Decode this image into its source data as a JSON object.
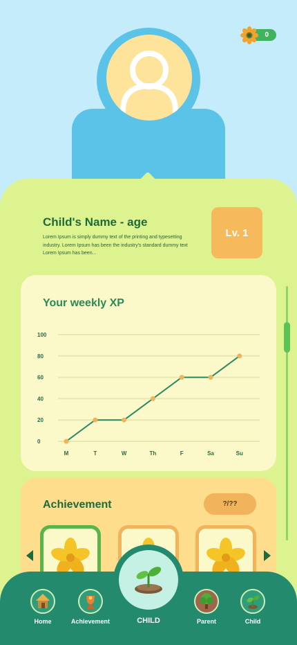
{
  "coins": {
    "count": "0"
  },
  "profile": {
    "name": "Child's Name - age",
    "description": "Lorem Ipsum is simply dummy text of the printing and typesetting industry. Lorem Ipsum has been the industry's standard dummy text Lorem Ipsum has been...",
    "level": "Lv. 1"
  },
  "weekly_xp": {
    "title": "Your weekly XP"
  },
  "chart_data": {
    "type": "line",
    "title": "Your weekly XP",
    "categories": [
      "M",
      "T",
      "W",
      "Th",
      "F",
      "Sa",
      "Su"
    ],
    "values": [
      0,
      20,
      20,
      40,
      60,
      60,
      80
    ],
    "yticks": [
      0,
      20,
      40,
      60,
      80,
      100
    ],
    "ylim": [
      0,
      100
    ],
    "grid": true,
    "line_color": "#2a8a62",
    "point_color": "#f0b35a"
  },
  "achievement": {
    "title": "Achievement",
    "count": "?/??",
    "badges": [
      {
        "name": "star-badge",
        "selected": true
      },
      {
        "name": "star-badge",
        "selected": false
      },
      {
        "name": "star-badge",
        "selected": false
      }
    ]
  },
  "nav": {
    "center_label": "CHILD",
    "items": [
      {
        "label": "Home",
        "icon": "hut-icon"
      },
      {
        "label": "Achievement",
        "icon": "trophy-icon"
      },
      {
        "label": "Parent",
        "icon": "tree-icon"
      },
      {
        "label": "Child",
        "icon": "sprout-icon"
      }
    ]
  }
}
